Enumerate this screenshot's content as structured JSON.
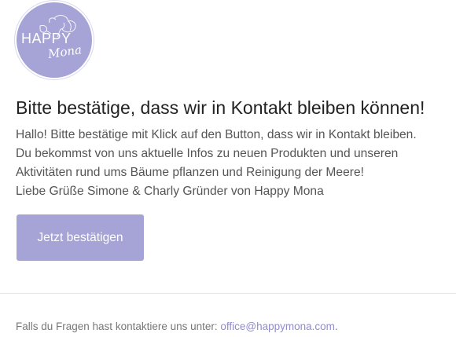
{
  "logo": {
    "line1": "HAPPY",
    "line2": "Mona"
  },
  "heading": "Bitte bestätige, dass wir in Kontakt bleiben können!",
  "body_lines": [
    "Hallo! Bitte bestätige mit Klick auf den Button, dass wir in Kontakt bleiben.",
    "Du bekommst von uns aktuelle Infos zu neuen Produkten und unseren",
    "Aktivitäten rund ums Bäume pflanzen und Reinigung der Meere!",
    "Liebe Grüße Simone & Charly Gründer von Happy Mona"
  ],
  "cta_label": "Jetzt bestätigen",
  "footer": {
    "prefix": "Falls du Fragen hast kontaktiere uns unter: ",
    "email": "office@happymona.com",
    "suffix": "."
  },
  "colors": {
    "brand": "#a6a3d6",
    "link": "#8f8ccf"
  }
}
